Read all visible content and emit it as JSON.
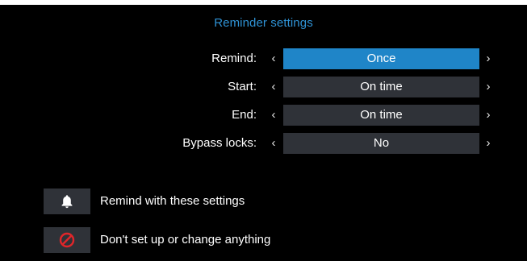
{
  "dialog": {
    "title": "Reminder settings"
  },
  "settings": [
    {
      "label": "Remind:",
      "value": "Once",
      "selected": true
    },
    {
      "label": "Start:",
      "value": "On time",
      "selected": false
    },
    {
      "label": "End:",
      "value": "On time",
      "selected": false
    },
    {
      "label": "Bypass locks:",
      "value": "No",
      "selected": false
    }
  ],
  "arrows": {
    "left": "‹",
    "right": "›"
  },
  "actions": [
    {
      "label": "Remind with these settings",
      "icon": "bell-icon"
    },
    {
      "label": "Don't set up or change anything",
      "icon": "cancel-icon"
    }
  ],
  "colors": {
    "title": "#2f93d6",
    "selected_value_bg": "#1f85c8",
    "value_bg": "#2f3238",
    "cancel_icon": "#e0262a"
  }
}
